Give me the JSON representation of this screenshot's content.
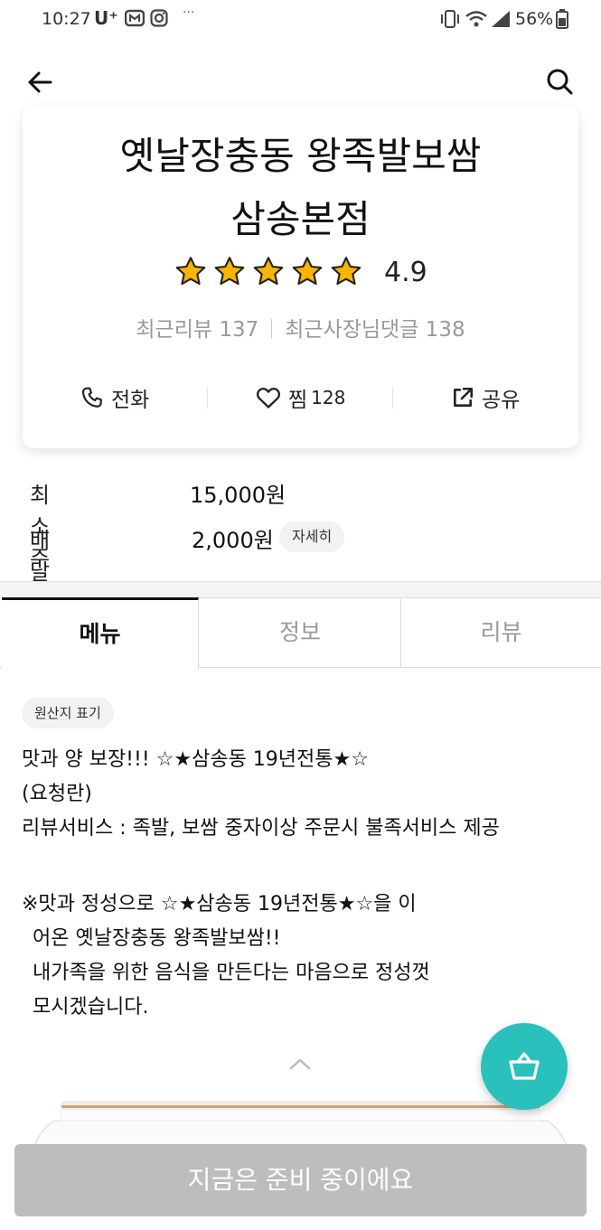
{
  "status_bar": {
    "time": "10:27",
    "carrier": "U⁺",
    "dots": "···",
    "battery": "56%"
  },
  "header": {
    "back_icon": "arrow-left-icon",
    "search_icon": "search-icon"
  },
  "store": {
    "name_line1": "옛날장충동 왕족발보쌈",
    "name_line2": "삼송본점",
    "rating": "4.9",
    "stars": 5,
    "recent_reviews": "최근리뷰 137",
    "owner_replies": "최근사장님댓글 138",
    "actions": {
      "call": "전화",
      "like": "찜",
      "like_count": "128",
      "share": "공유"
    }
  },
  "delivery": {
    "min_order_label": "최소주문금액",
    "min_order_value": "15,000원",
    "tip_label": "배달팁",
    "tip_value": "2,000원",
    "detail_button": "자세히"
  },
  "tabs": [
    {
      "label": "메뉴",
      "active": true
    },
    {
      "label": "정보",
      "active": false
    },
    {
      "label": "리뷰",
      "active": false
    }
  ],
  "notice": {
    "origin_badge": "원산지 표기",
    "lines": [
      "맛과 양 보장!!! ☆★삼송동 19년전통★☆",
      "(요청란)",
      "리뷰서비스 : 족발, 보쌈  중자이상 주문시 불족서비스 제공",
      "",
      "※맛과 정성으로 ☆★삼송동 19년전통★☆을 이",
      "  어온 옛날장충동 왕족발보쌈!!",
      "  내가족을 위한 음식을 만든다는 마음으로 정성껏",
      "  모시겠습니다."
    ]
  },
  "bottom_button": "지금은 준비 중이에요",
  "colors": {
    "accent": "#2ac1bc",
    "star": "#f7b500",
    "disabled_button": "#bdbdbd"
  }
}
